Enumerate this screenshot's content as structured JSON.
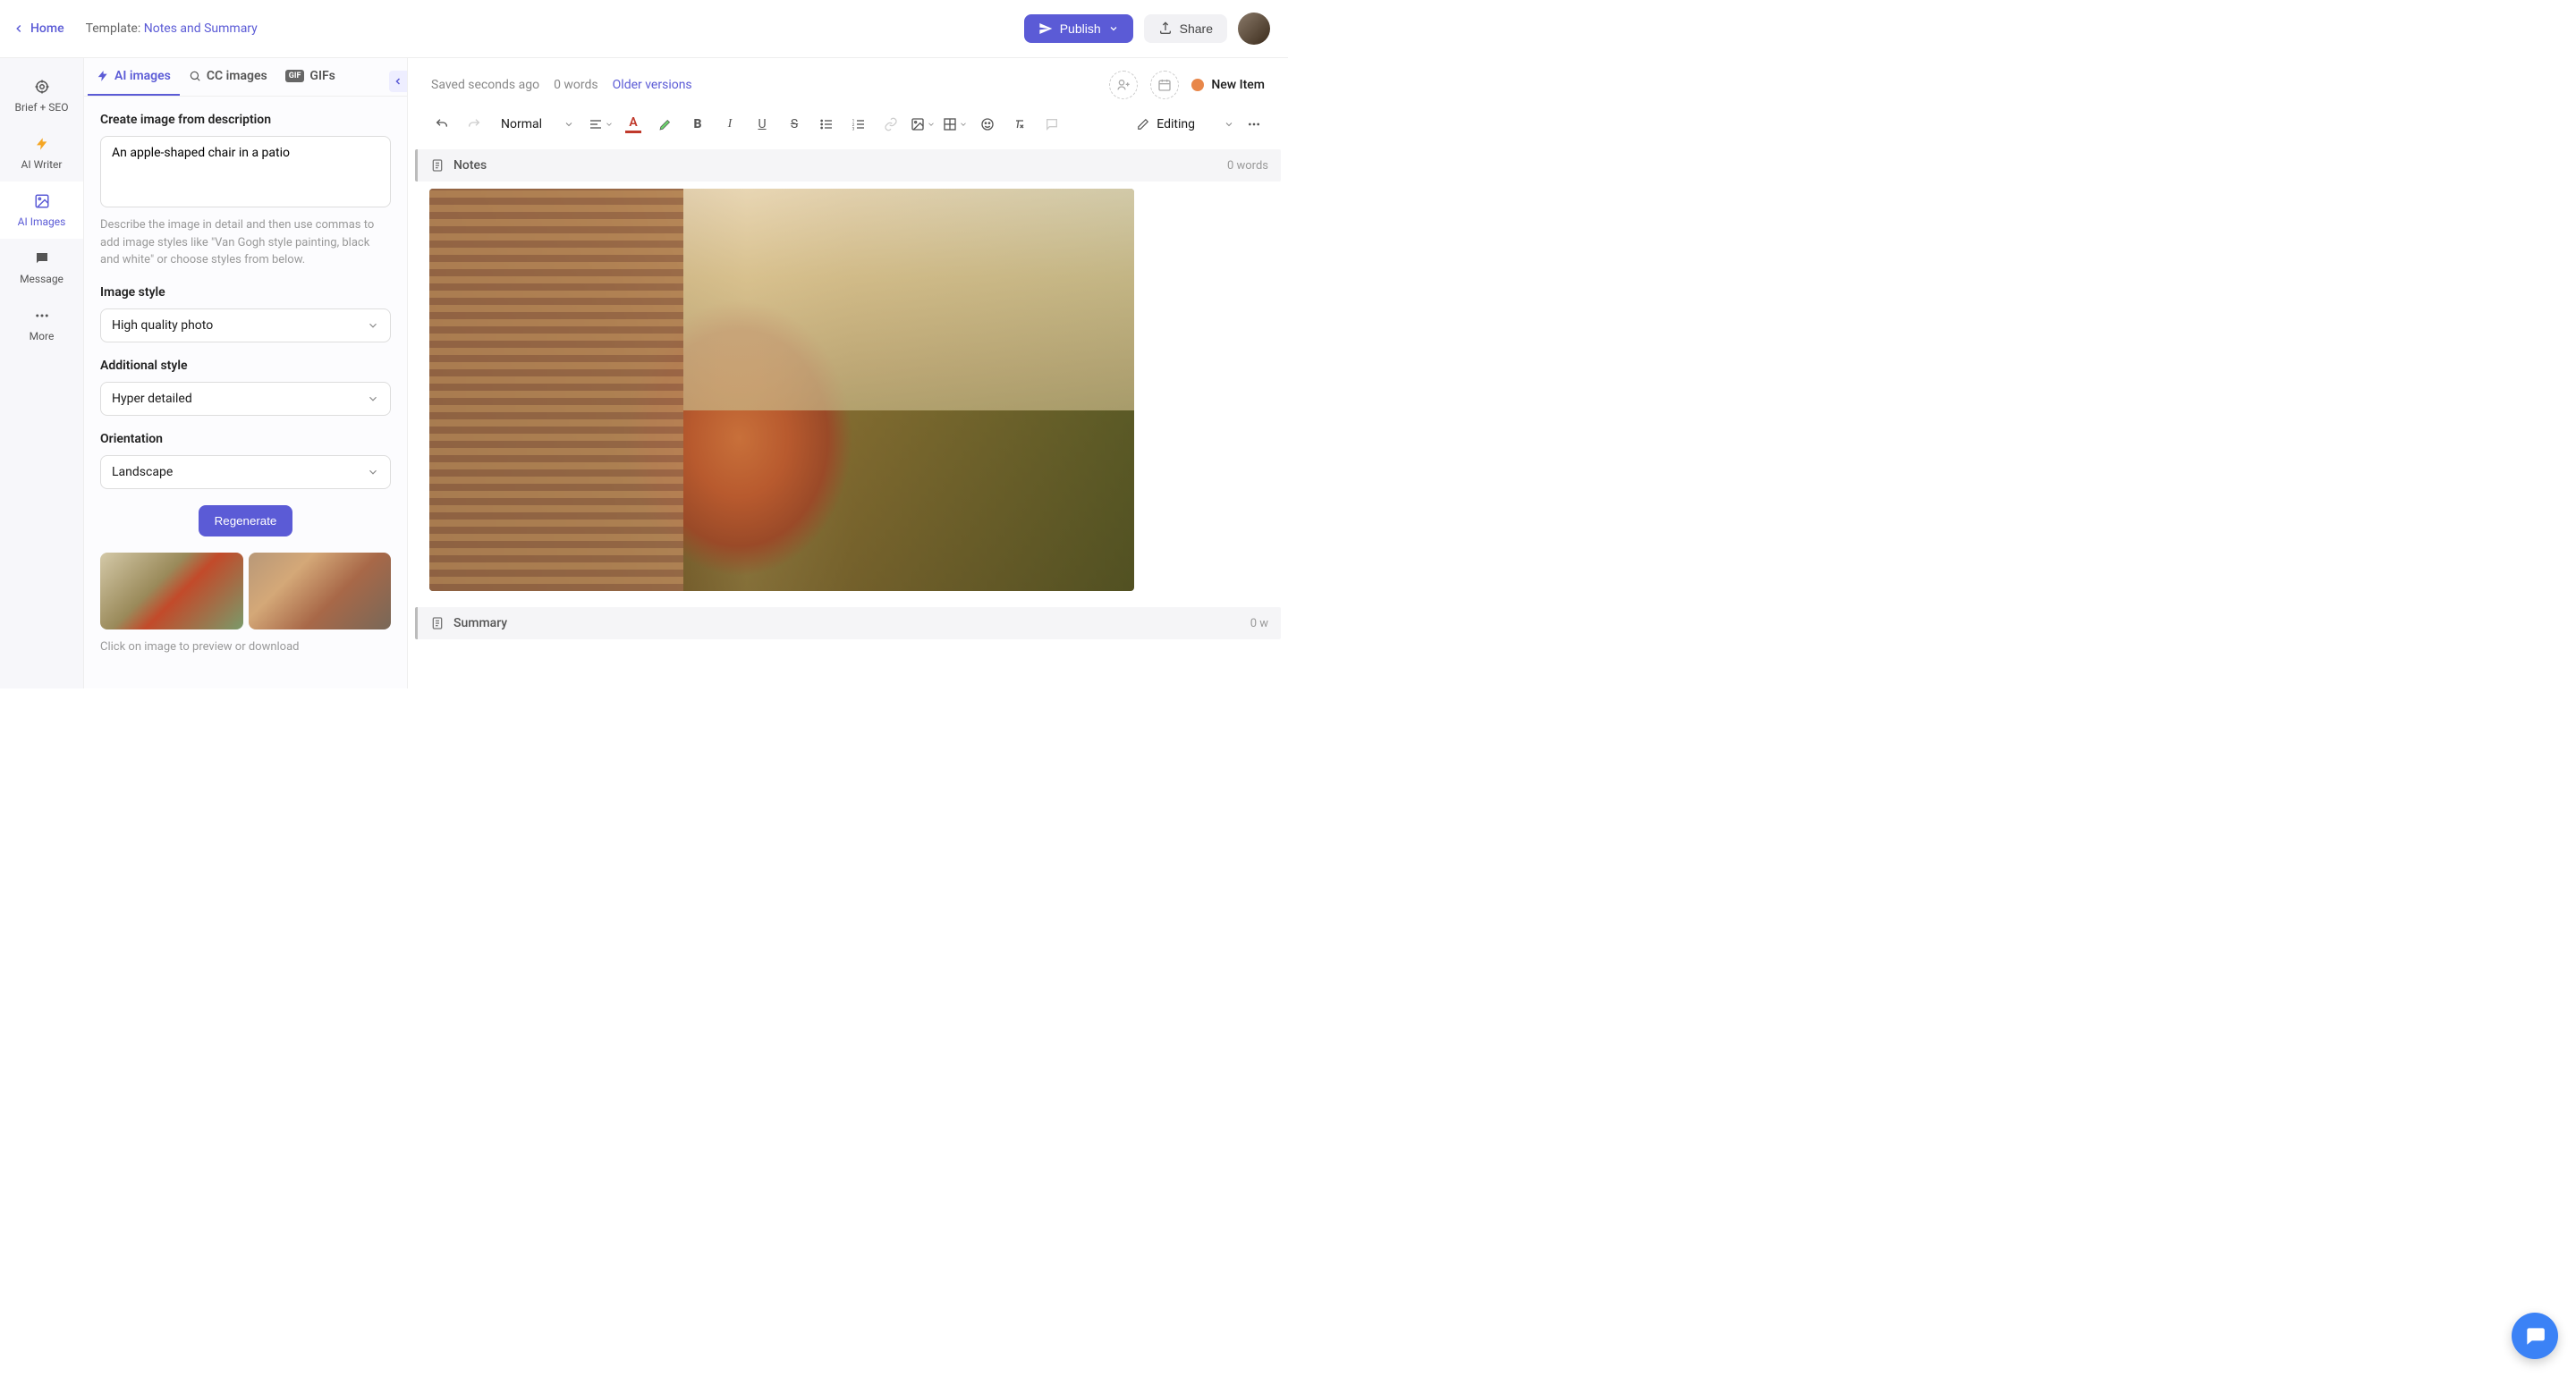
{
  "topbar": {
    "home": "Home",
    "template_prefix": "Template: ",
    "template_name": "Notes and Summary",
    "publish": "Publish",
    "share": "Share"
  },
  "rail": {
    "items": [
      {
        "label": "Brief + SEO"
      },
      {
        "label": "AI Writer"
      },
      {
        "label": "AI Images"
      },
      {
        "label": "Message"
      },
      {
        "label": "More"
      }
    ]
  },
  "panel": {
    "tabs": {
      "ai_images": "AI images",
      "cc_images": "CC images",
      "gifs": "GIFs",
      "gif_badge": "GIF"
    },
    "create_label": "Create image from description",
    "prompt_value": "An apple-shaped chair in a patio",
    "helper": "Describe the image in detail and then use commas to add image styles like \"Van Gogh style painting, black and white\" or choose styles from below.",
    "image_style_label": "Image style",
    "image_style_value": "High quality photo",
    "additional_style_label": "Additional style",
    "additional_style_value": "Hyper detailed",
    "orientation_label": "Orientation",
    "orientation_value": "Landscape",
    "regenerate": "Regenerate",
    "thumb_hint": "Click on image to preview or download"
  },
  "main": {
    "saved": "Saved seconds ago",
    "words": "0 words",
    "older": "Older versions",
    "new_item": "New Item",
    "format_style": "Normal",
    "editing": "Editing",
    "sections": {
      "notes": {
        "title": "Notes",
        "words": "0 words"
      },
      "summary": {
        "title": "Summary",
        "words": "0 w"
      }
    }
  }
}
